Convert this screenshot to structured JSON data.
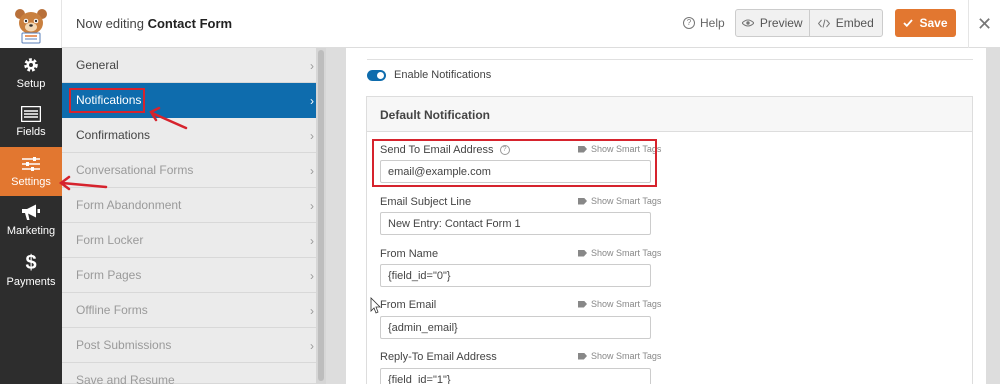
{
  "header": {
    "editing_prefix": "Now editing",
    "form_name": "Contact Form",
    "help_label": "Help",
    "preview_label": "Preview",
    "embed_label": "Embed",
    "save_label": "Save",
    "help_icon": "question-circle-icon",
    "preview_icon": "eye-icon",
    "embed_icon": "code-icon",
    "save_icon": "checkmark-icon",
    "close_icon": "close-icon",
    "logo_icon": "bear-mascot-logo"
  },
  "icon_panel": {
    "items": [
      {
        "label": "Setup",
        "icon": "gear-icon"
      },
      {
        "label": "Fields",
        "icon": "list-icon"
      },
      {
        "label": "Settings",
        "icon": "sliders-icon",
        "active": true
      },
      {
        "label": "Marketing",
        "icon": "megaphone-icon"
      },
      {
        "label": "Payments",
        "icon": "dollar-icon"
      }
    ]
  },
  "settings_panel": {
    "items": [
      {
        "label": "General"
      },
      {
        "label": "Notifications",
        "active": true
      },
      {
        "label": "Confirmations"
      },
      {
        "label": "Conversational Forms",
        "dim": true
      },
      {
        "label": "Form Abandonment",
        "dim": true
      },
      {
        "label": "Form Locker",
        "dim": true
      },
      {
        "label": "Form Pages",
        "dim": true
      },
      {
        "label": "Offline Forms",
        "dim": true
      },
      {
        "label": "Post Submissions",
        "dim": true
      },
      {
        "label": "Save and Resume",
        "dim": true
      }
    ]
  },
  "notifications": {
    "enable_label": "Enable Notifications",
    "enabled": true,
    "box_title": "Default Notification",
    "smart_tags_label": "Show Smart Tags",
    "fields": [
      {
        "label": "Send To Email Address",
        "value": "email@example.com",
        "has_help": true
      },
      {
        "label": "Email Subject Line",
        "value": "New Entry: Contact Form 1"
      },
      {
        "label": "From Name",
        "value": "{field_id=\"0\"}"
      },
      {
        "label": "From Email",
        "value": "{admin_email}"
      },
      {
        "label": "Reply-To Email Address",
        "value": "{field_id=\"1\"}"
      }
    ]
  },
  "colors": {
    "accent_orange": "#e27730",
    "active_blue": "#0e6cad",
    "sidebar_dark": "#2d2d2d",
    "annotation_red": "#d6232d"
  }
}
